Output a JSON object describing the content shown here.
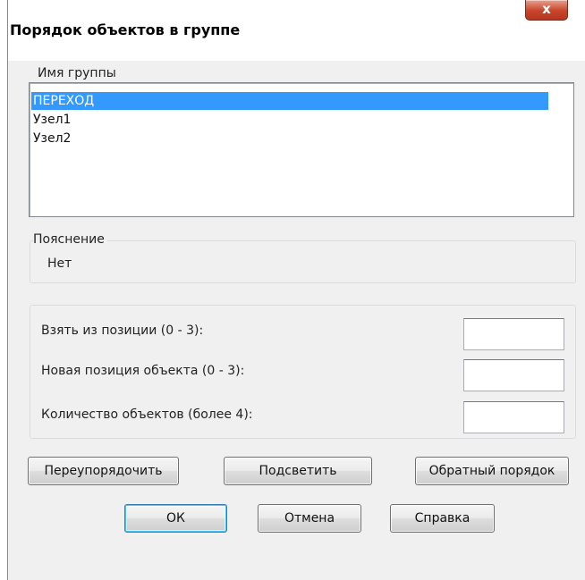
{
  "window": {
    "title": "Порядок объектов в группе",
    "close_symbol": "x",
    "close_icon": "close-icon"
  },
  "group_list": {
    "label": "Имя группы",
    "items": [
      {
        "label": "ПЕРЕХОД",
        "selected": true
      },
      {
        "label": "Узел1",
        "selected": false
      },
      {
        "label": "Узел2",
        "selected": false
      }
    ]
  },
  "explanation": {
    "label": "Пояснение",
    "value": "Нет"
  },
  "fields": [
    {
      "label": "Взять из позиции (0 - 3):",
      "value": ""
    },
    {
      "label": "Новая позиция объекта (0 - 3):",
      "value": ""
    },
    {
      "label": "Количество объектов (более 4):",
      "value": ""
    }
  ],
  "actions": {
    "reorder": "Переупорядочить",
    "highlight": "Подсветить",
    "reverse": "Обратный порядок"
  },
  "dialog_buttons": {
    "ok": "ОК",
    "cancel": "Отмена",
    "help": "Справка"
  },
  "colors": {
    "selection": "#3399ff",
    "close_button": "#c8452c",
    "dialog_bg": "#f0f0f0"
  }
}
